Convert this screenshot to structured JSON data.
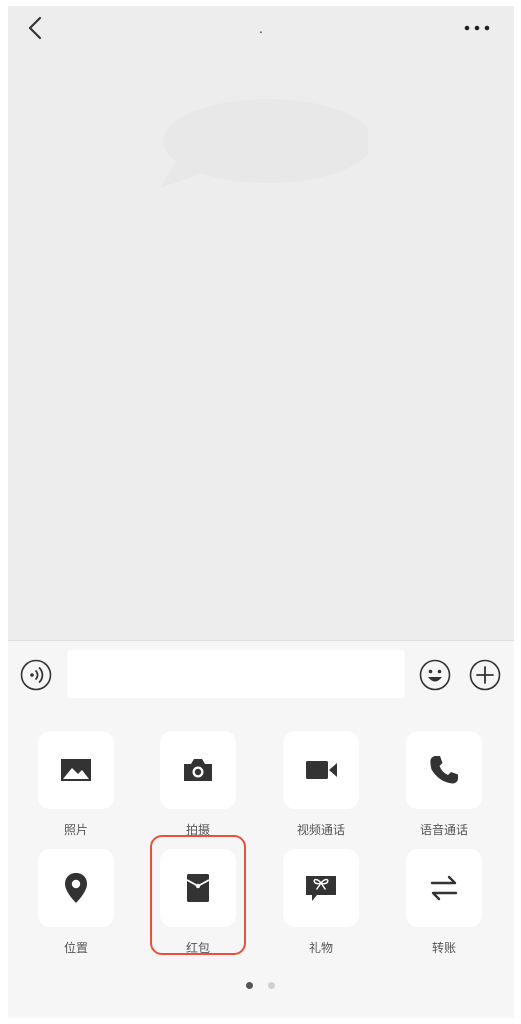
{
  "header": {
    "title": "."
  },
  "input_bar": {
    "message_value": "",
    "message_placeholder": ""
  },
  "actions": {
    "photo": "照片",
    "camera": "拍摄",
    "video_call": "视频通话",
    "voice_call": "语音通话",
    "location": "位置",
    "red_packet": "红包",
    "gift": "礼物",
    "transfer": "转账"
  },
  "icons": {
    "back": "chevron-left-icon",
    "more": "more-dots-icon",
    "voice": "voice-icon",
    "emoji": "emoji-icon",
    "plus": "plus-icon",
    "photo": "image-icon",
    "camera": "camera-icon",
    "video": "video-icon",
    "phone": "phone-icon",
    "location": "location-pin-icon",
    "red_packet": "red-packet-icon",
    "gift": "gift-icon",
    "transfer": "transfer-arrows-icon"
  },
  "pagination": {
    "pages": 2,
    "current": 1
  },
  "colors": {
    "highlight": "#e8513a",
    "chat_bg": "#ededed",
    "panel_bg": "#f6f6f6",
    "icon": "#333333"
  }
}
